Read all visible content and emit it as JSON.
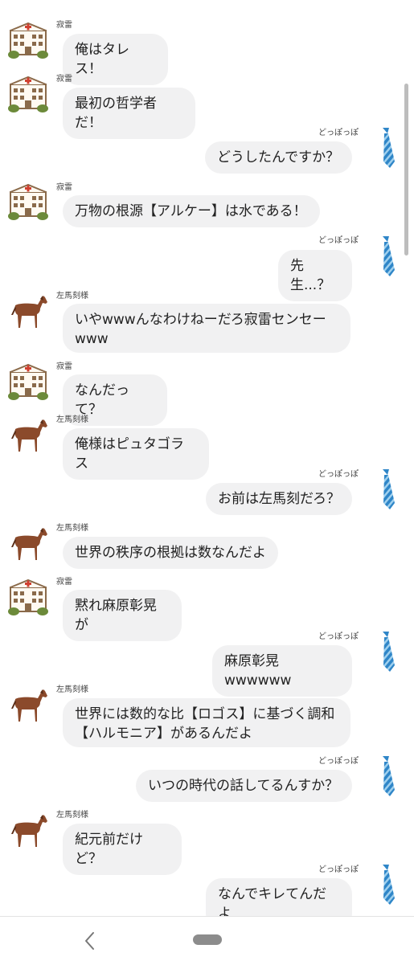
{
  "users": {
    "jakurai": "寂雷",
    "sama": "左馬刻様",
    "doppo": "どっぽっぽ"
  },
  "messages": [
    {
      "sender": "寂雷",
      "text": "俺はタレス！"
    },
    {
      "sender": "寂雷",
      "text": "最初の哲学者だ！"
    },
    {
      "sender": "どっぽっぽ",
      "text": "どうしたんですか？"
    },
    {
      "sender": "寂雷",
      "text": "万物の根源【アルケー】は水である！"
    },
    {
      "sender": "どっぽっぽ",
      "text": "先生...？"
    },
    {
      "sender": "左馬刻様",
      "text": "いやwwwんなわけねーだろ寂雷センセー\nwww"
    },
    {
      "sender": "寂雷",
      "text": "なんだって？"
    },
    {
      "sender": "左馬刻様",
      "text": "俺様はピュタゴラス"
    },
    {
      "sender": "どっぽっぽ",
      "text": "お前は左馬刻だろ？"
    },
    {
      "sender": "左馬刻様",
      "text": "世界の秩序の根拠は数なんだよ"
    },
    {
      "sender": "寂雷",
      "text": "黙れ麻原彰晃が"
    },
    {
      "sender": "どっぽっぽ",
      "text": "麻原彰晃wwwwww"
    },
    {
      "sender": "左馬刻様",
      "text": "世界には数的な比【ロゴス】に基づく調和\n【ハルモニア】があるんだよ"
    },
    {
      "sender": "どっぽっぽ",
      "text": "いつの時代の話してるんすか？"
    },
    {
      "sender": "左馬刻様",
      "text": "紀元前だけど？"
    },
    {
      "sender": "どっぽっぽ",
      "text": "なんでキレてんだよ"
    }
  ],
  "icons": {
    "jakurai_avatar": "hospital-building-icon",
    "sama_avatar": "horse-icon",
    "doppo_avatar": "blue-striped-tie-icon",
    "nav_back": "chevron-left-icon",
    "nav_home": "home-pill-icon"
  },
  "colors": {
    "bubble": "#f1f1f2",
    "tie_blue": "#2f86c8",
    "tie_light": "#9fd0ee",
    "horse": "#8b4a2b",
    "building": "#8a6a4a",
    "cross": "#d04030",
    "bush": "#6c8a3a"
  }
}
